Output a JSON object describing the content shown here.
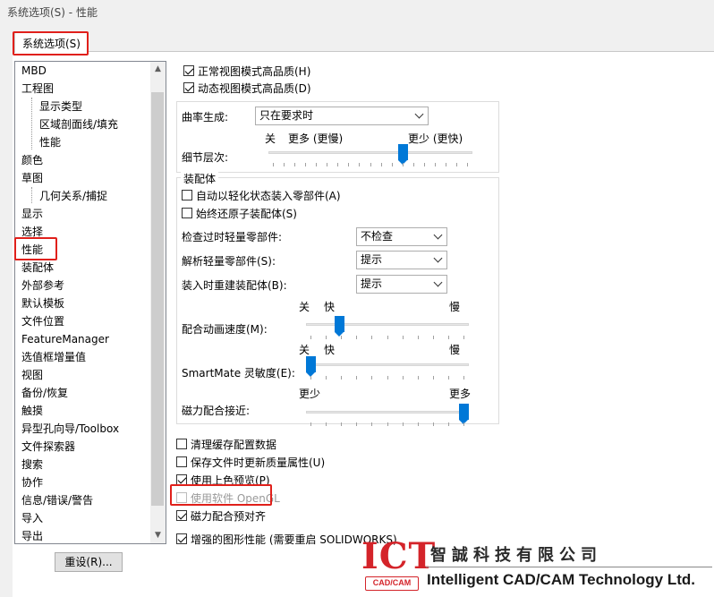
{
  "window": {
    "title": "系统选项(S) - 性能"
  },
  "tabs": [
    {
      "label": "系统选项(S)"
    }
  ],
  "tree": {
    "items": [
      {
        "label": "MBD",
        "level": 0
      },
      {
        "label": "工程图",
        "level": 0
      },
      {
        "label": "显示类型",
        "level": 1
      },
      {
        "label": "区域剖面线/填充",
        "level": 1
      },
      {
        "label": "性能",
        "level": 1
      },
      {
        "label": "颜色",
        "level": 0
      },
      {
        "label": "草图",
        "level": 0
      },
      {
        "label": "几何关系/捕捉",
        "level": 1
      },
      {
        "label": "显示",
        "level": 0
      },
      {
        "label": "选择",
        "level": 0
      },
      {
        "label": "性能",
        "level": 0,
        "selected": true
      },
      {
        "label": "装配体",
        "level": 0
      },
      {
        "label": "外部参考",
        "level": 0
      },
      {
        "label": "默认模板",
        "level": 0
      },
      {
        "label": "文件位置",
        "level": 0
      },
      {
        "label": "FeatureManager",
        "level": 0
      },
      {
        "label": "选值框增量值",
        "level": 0
      },
      {
        "label": "视图",
        "level": 0
      },
      {
        "label": "备份/恢复",
        "level": 0
      },
      {
        "label": "触摸",
        "level": 0
      },
      {
        "label": "异型孔向导/Toolbox",
        "level": 0
      },
      {
        "label": "文件探索器",
        "level": 0
      },
      {
        "label": "搜索",
        "level": 0
      },
      {
        "label": "协作",
        "level": 0
      },
      {
        "label": "信息/错误/警告",
        "level": 0
      },
      {
        "label": "导入",
        "level": 0
      },
      {
        "label": "导出",
        "level": 0
      }
    ]
  },
  "reset_button": {
    "label": "重设(R)..."
  },
  "options": {
    "normal_view_hq": {
      "label": "正常视图模式高品质(H)",
      "checked": true
    },
    "dynamic_view_hq": {
      "label": "动态视图模式高品质(D)",
      "checked": true
    },
    "curvature": {
      "label": "曲率生成:",
      "value": "只在要求时"
    },
    "detail_level": {
      "label": "细节层次:",
      "left_label": "关",
      "left2_label": "更多 (更慢)",
      "right_label": "更少 (更快)",
      "value_fraction": 0.67
    },
    "assembly_group": {
      "title": "装配体",
      "auto_load_lightweight": {
        "label": "自动以轻化状态装入零部件(A)",
        "checked": false
      },
      "always_resolve_sub": {
        "label": "始终还原子装配体(S)",
        "checked": false
      },
      "check_outdated": {
        "label": "检查过时轻量零部件:",
        "value": "不检查"
      },
      "resolve_lightweight": {
        "label": "解析轻量零部件(S):",
        "value": "提示"
      },
      "rebuild_on_load": {
        "label": "装入时重建装配体(B):",
        "value": "提示"
      },
      "mate_animation": {
        "label": "配合动画速度(M):",
        "off_label": "关",
        "fast_label": "快",
        "slow_label": "慢",
        "value_fraction": 0.19
      },
      "smartmate": {
        "label": "SmartMate 灵敏度(E):",
        "off_label": "关",
        "fast_label": "快",
        "slow_label": "慢",
        "value_fraction": 0.0
      },
      "magnetic_mate": {
        "label": "磁力配合接近:",
        "less_label": "更少",
        "more_label": "更多",
        "value_fraction": 1.0
      }
    },
    "purge_cache": {
      "label": "清理缓存配置数据",
      "checked": false
    },
    "update_mass": {
      "label": "保存文件时更新质量属性(U)",
      "checked": false
    },
    "shaded_preview": {
      "label": "使用上色预览(P)",
      "checked": true
    },
    "software_opengl": {
      "label": "使用软件 OpenGL",
      "checked": false,
      "disabled": true
    },
    "magnetic_prealign": {
      "label": "磁力配合预对齐",
      "checked": true
    },
    "enhanced_graphics": {
      "label": "增强的图形性能 (需要重启 SOLIDWORKS)",
      "checked": true
    }
  },
  "branding": {
    "logo_text": "ICT",
    "logo_sub": "CAD/CAM",
    "company_cn": "智誠科技有限公司",
    "company_en": "Intelligent CAD/CAM Technology Ltd.",
    "brand_color": "#d4242a"
  },
  "colors": {
    "highlight_red": "#e0201b",
    "slider_blue": "#0078d7"
  }
}
